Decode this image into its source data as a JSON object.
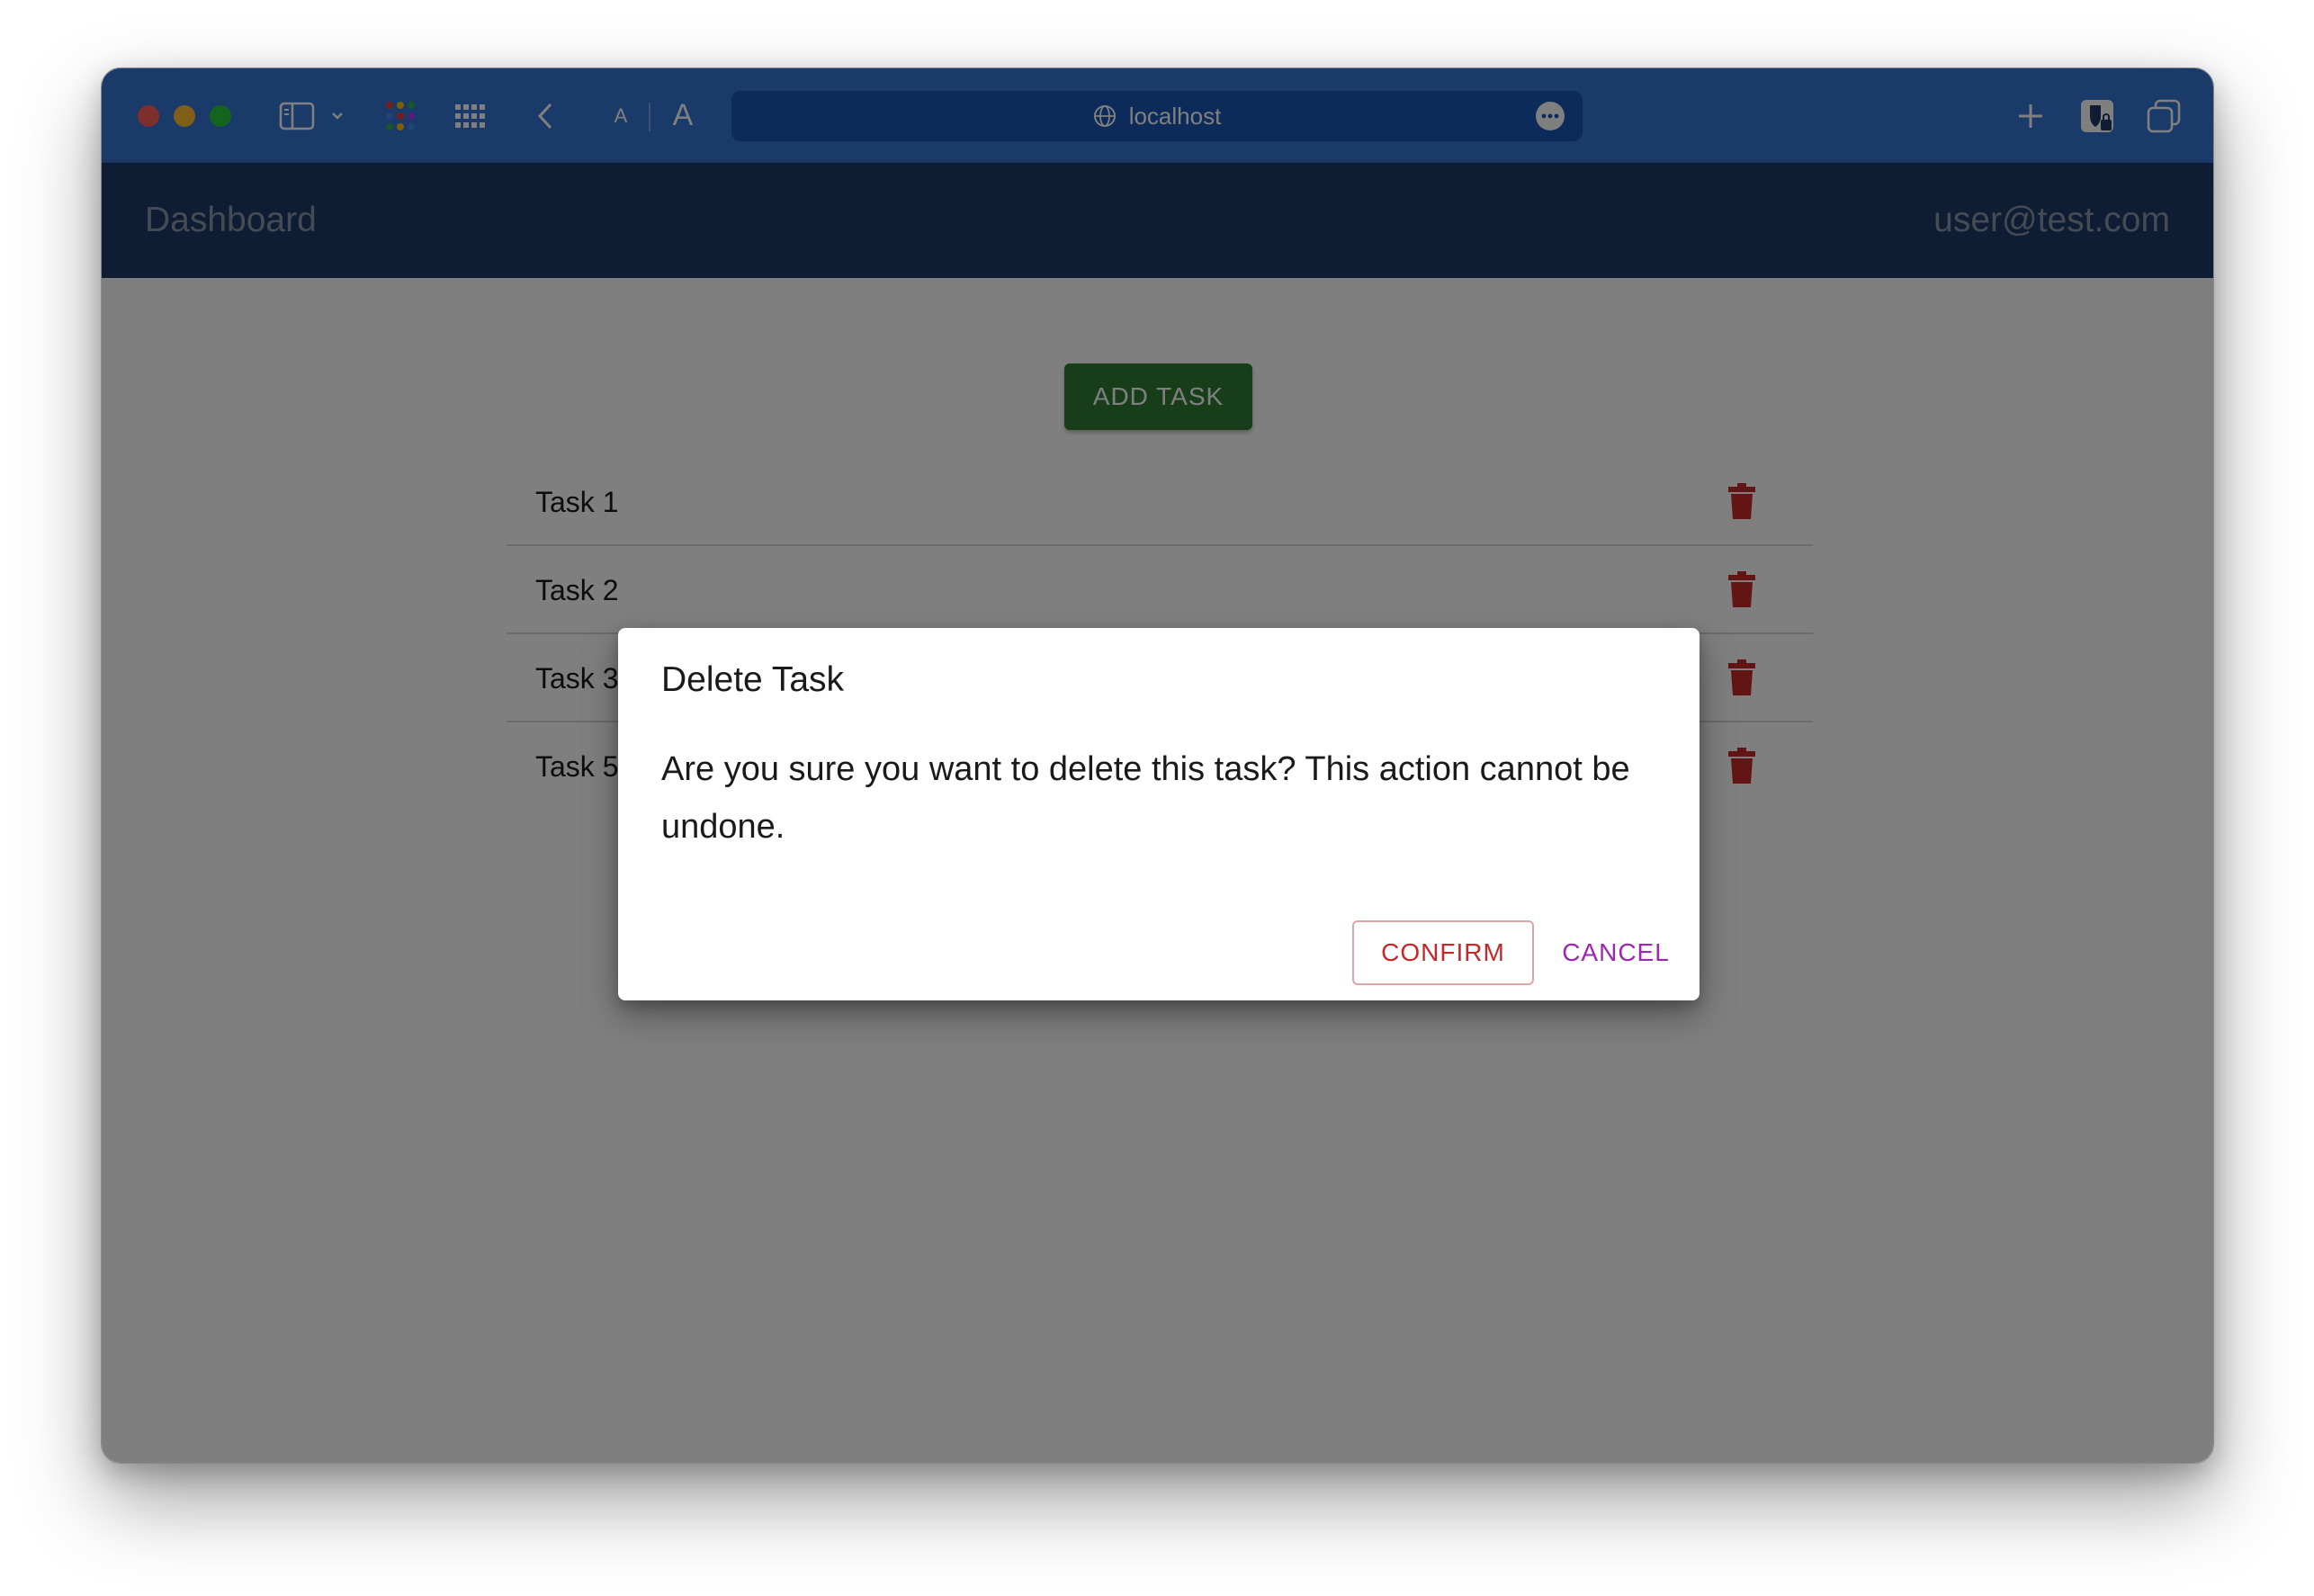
{
  "browser": {
    "url": "localhost",
    "text_size_small": "A",
    "text_size_large": "A"
  },
  "appbar": {
    "title": "Dashboard",
    "user": "user@test.com"
  },
  "main": {
    "add_task_label": "ADD TASK",
    "tasks": [
      {
        "label": "Task 1"
      },
      {
        "label": "Task 2"
      },
      {
        "label": "Task 3"
      },
      {
        "label": "Task 5"
      }
    ]
  },
  "dialog": {
    "title": "Delete Task",
    "message": "Are you sure you want to delete this task? This action cannot be undone.",
    "confirm_label": "CONFIRM",
    "cancel_label": "CANCEL"
  },
  "colors": {
    "chrome": "#3574d4",
    "appbar": "#1c3a68",
    "add_button": "#2e7d32",
    "delete_icon": "#c62828",
    "confirm": "#c62828",
    "cancel": "#9c27b0"
  }
}
